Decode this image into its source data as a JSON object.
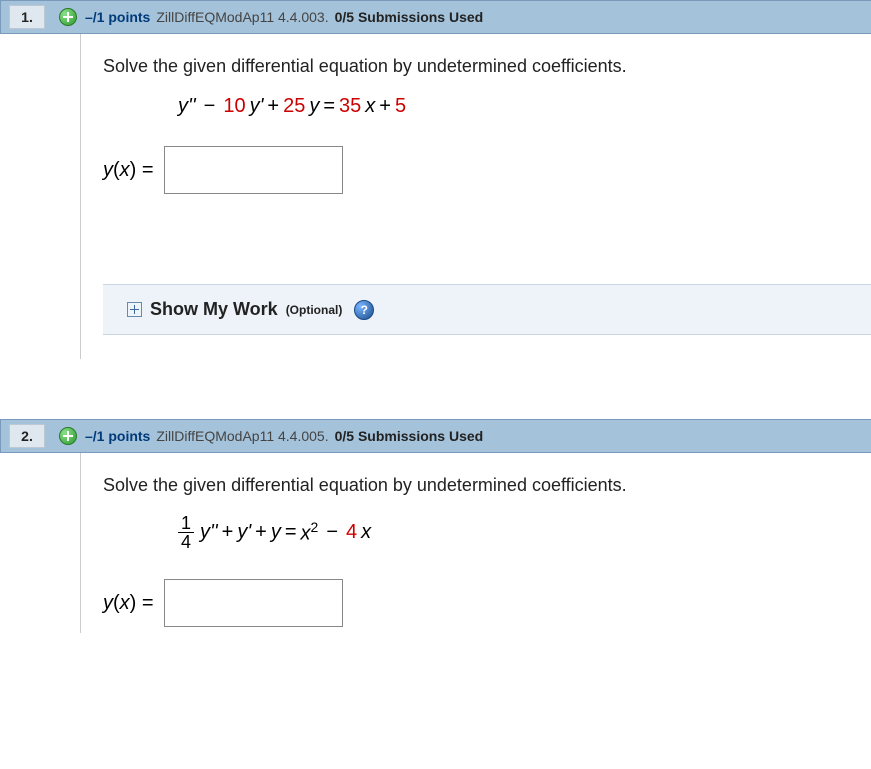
{
  "questions": [
    {
      "number": "1.",
      "points": "–/1 points",
      "source": "ZillDiffEQModAp11 4.4.003.",
      "submissions": "0/5 Submissions Used",
      "prompt": "Solve the given differential equation by undetermined coefficients.",
      "eq": {
        "y2": "y''",
        "m1": "−",
        "c1": "10",
        "y1": "y'",
        "p1": "+",
        "c2": "25",
        "y0": "y",
        "eq": "=",
        "c3": "35",
        "x": "x",
        "p2": "+",
        "c4": "5"
      },
      "ans_label_y": "y",
      "ans_label_x": "x",
      "ans_label_rest": ") =",
      "ans_label_open": "(",
      "smw": "Show My Work",
      "smw_opt": "(Optional)",
      "help": "?"
    },
    {
      "number": "2.",
      "points": "–/1 points",
      "source": "ZillDiffEQModAp11 4.4.005.",
      "submissions": "0/5 Submissions Used",
      "prompt": "Solve the given differential equation by undetermined coefficients.",
      "eq": {
        "fnum": "1",
        "fden": "4",
        "y2": "y''",
        "p1": "+",
        "y1": "y'",
        "p2": "+",
        "y0": "y",
        "eq": "=",
        "x": "x",
        "exp": "2",
        "m1": "−",
        "c1": "4",
        "x2": "x"
      },
      "ans_label_y": "y",
      "ans_label_x": "x",
      "ans_label_rest": ") =",
      "ans_label_open": "("
    }
  ]
}
